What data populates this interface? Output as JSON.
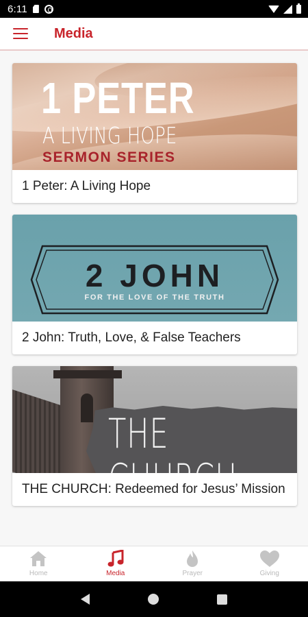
{
  "status_bar": {
    "time": "6:11"
  },
  "app_bar": {
    "title": "Media"
  },
  "media_items": [
    {
      "title": "1 Peter: A Living Hope",
      "art": {
        "line1": "1 PETER",
        "line2": "A LIVING HOPE",
        "line3": "SERMON SERIES"
      }
    },
    {
      "title": "2 John: Truth, Love, & False Teachers",
      "art": {
        "line1": "2 JOHN",
        "line2": "FOR THE LOVE OF THE TRUTH"
      }
    },
    {
      "title": "THE CHURCH: Redeemed for Jesus’ Mission",
      "art": {
        "line1": "THE CHURCH"
      }
    }
  ],
  "bottom_nav": {
    "items": [
      {
        "label": "Home",
        "icon": "home-icon",
        "active": false
      },
      {
        "label": "Media",
        "icon": "music-note-icon",
        "active": true
      },
      {
        "label": "Prayer",
        "icon": "flame-icon",
        "active": false
      },
      {
        "label": "Giving",
        "icon": "heart-icon",
        "active": false
      }
    ]
  },
  "colors": {
    "accent": "#c8242b",
    "inactive": "#b9b9b9"
  }
}
